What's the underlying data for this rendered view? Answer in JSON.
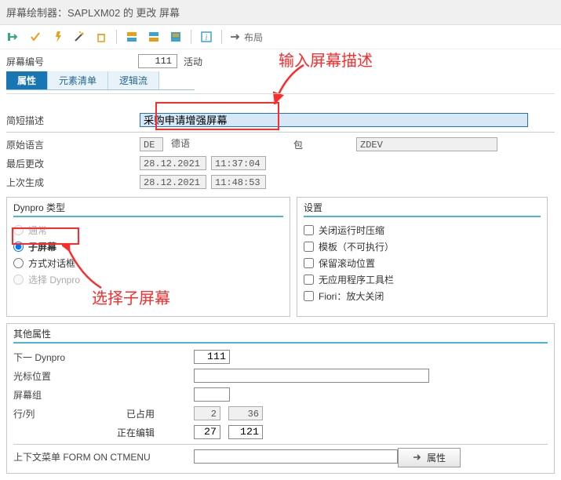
{
  "title": "屏幕绘制器：SAPLXM02 的 更改 屏幕",
  "toolbar": {
    "layout": "布局"
  },
  "screen": {
    "label": "屏幕编号",
    "number": "111",
    "status": "活动"
  },
  "tabs": {
    "attributes": "属性",
    "elements": "元素清单",
    "flow": "逻辑流"
  },
  "attr": {
    "short_desc_label": "简短描述",
    "short_desc_value": "采购申请增强屏幕",
    "orig_lang_label": "原始语言",
    "orig_lang_code": "DE",
    "orig_lang_text": "德语",
    "package_label": "包",
    "package_value": "ZDEV",
    "last_change_label": "最后更改",
    "last_change_date": "28.12.2021",
    "last_change_time": "11:37:04",
    "last_gen_label": "上次生成",
    "last_gen_date": "28.12.2021",
    "last_gen_time": "11:48:53"
  },
  "dynpro": {
    "title": "Dynpro 类型",
    "normal": "通常",
    "subscreen": "子屏幕",
    "dialog": "方式对话框",
    "select": "选择 Dynpro"
  },
  "settings": {
    "title": "设置",
    "opt1": "关闭运行时压缩",
    "opt2": "模板（不可执行）",
    "opt3": "保留滚动位置",
    "opt4": "无应用程序工具栏",
    "opt5": "Fiori：放大关闭"
  },
  "other": {
    "title": "其他属性",
    "next_dynpro_label": "下一 Dynpro",
    "next_dynpro_value": "111",
    "cursor_label": "光标位置",
    "group_label": "屏幕组",
    "rowcol_label": "行/列",
    "occupied_label": "已占用",
    "occupied_row": "2",
    "occupied_col": "36",
    "editing_label": "正在编辑",
    "editing_row": "27",
    "editing_col": "121",
    "context_label": "上下文菜单 FORM ON CTMENU",
    "prop_button": "属性"
  },
  "annot": {
    "desc": "输入屏幕描述",
    "sub": "选择子屏幕"
  }
}
